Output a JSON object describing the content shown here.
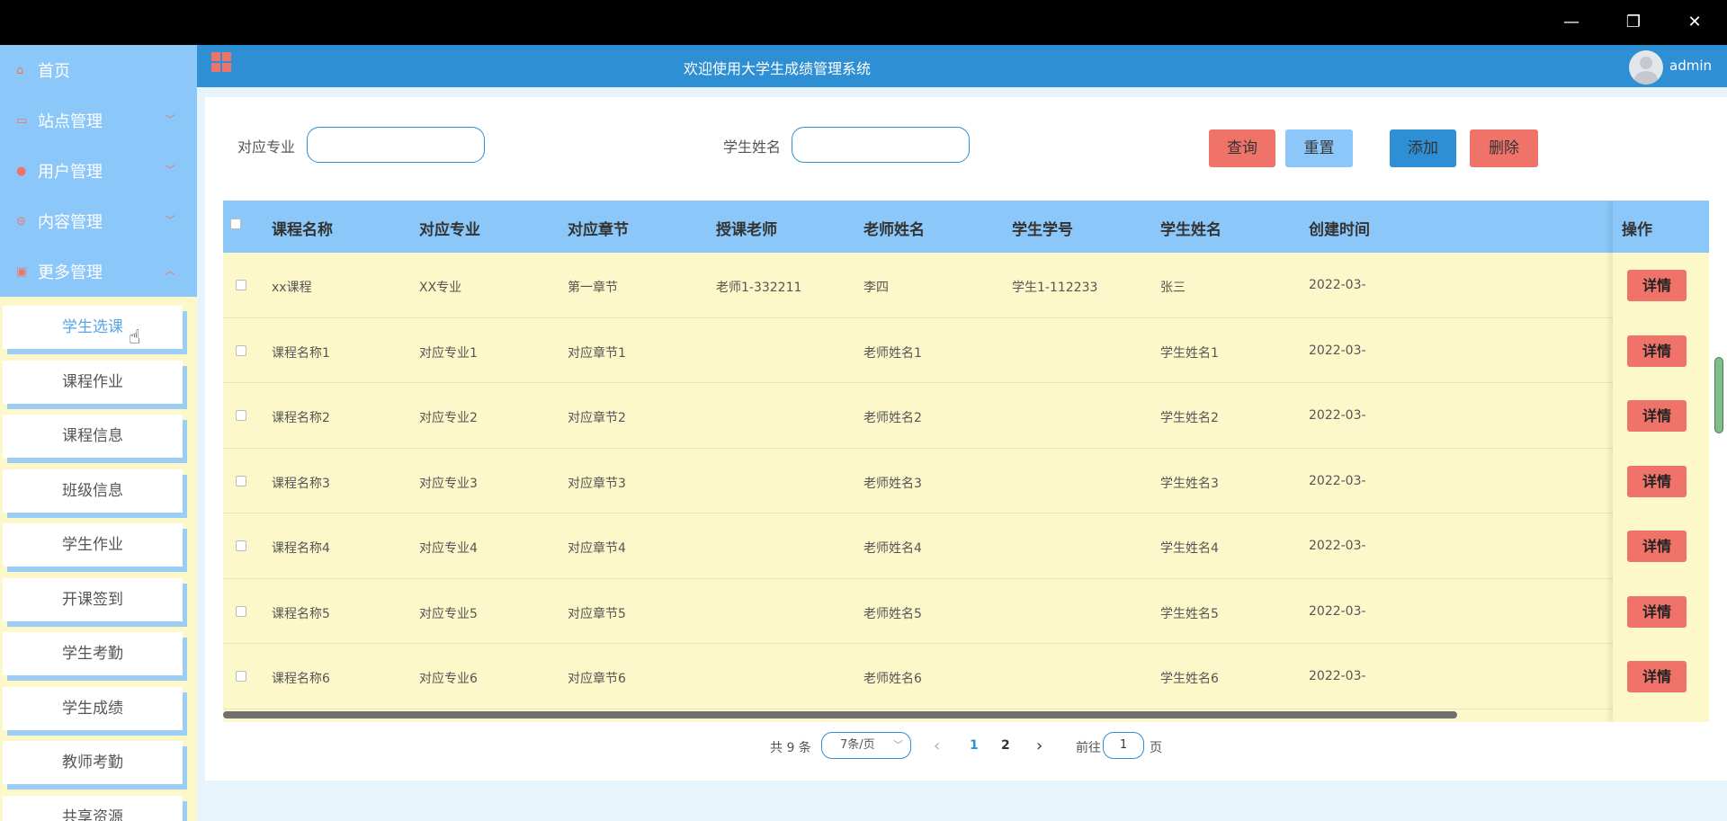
{
  "window": {
    "minimize": "—",
    "restore": "❐",
    "close": "✕"
  },
  "sidebar": {
    "menu": [
      {
        "label": "首页",
        "icon": "home-icon",
        "glyph": "⌂"
      },
      {
        "label": "站点管理",
        "icon": "monitor-icon",
        "glyph": "▭",
        "chevron": "﹀"
      },
      {
        "label": "用户管理",
        "icon": "user-icon",
        "glyph": "●",
        "chevron": "﹀"
      },
      {
        "label": "内容管理",
        "icon": "content-icon",
        "glyph": "⊝",
        "chevron": "﹀"
      },
      {
        "label": "更多管理",
        "icon": "more-icon",
        "glyph": "▣",
        "chevron": "︿"
      }
    ],
    "submenu": [
      "学生选课",
      "课程作业",
      "课程信息",
      "班级信息",
      "学生作业",
      "开课签到",
      "学生考勤",
      "学生成绩",
      "教师考勤",
      "共享资源"
    ]
  },
  "header": {
    "title": "欢迎使用大学生成绩管理系统",
    "username": "admin"
  },
  "search": {
    "major_label": "对应专业",
    "name_label": "学生姓名"
  },
  "buttons": {
    "query": "查询",
    "reset": "重置",
    "add": "添加",
    "delete": "删除"
  },
  "colors": {
    "primary": "#2e8fd4",
    "danger": "#f0736a",
    "header_bg": "#8cc7f9",
    "row_bg": "#fdf8c9",
    "reset_bg": "#8cc7f9"
  },
  "table": {
    "headers": [
      "课程名称",
      "对应专业",
      "对应章节",
      "授课老师",
      "老师姓名",
      "学生学号",
      "学生姓名",
      "创建时间",
      "操作"
    ],
    "detail_label": "详情",
    "rows": [
      [
        "xx课程",
        "XX专业",
        "第一章节",
        "老师1-332211",
        "李四",
        "学生1-112233",
        "张三",
        "2022-03-"
      ],
      [
        "课程名称1",
        "对应专业1",
        "对应章节1",
        "",
        "老师姓名1",
        "",
        "学生姓名1",
        "2022-03-"
      ],
      [
        "课程名称2",
        "对应专业2",
        "对应章节2",
        "",
        "老师姓名2",
        "",
        "学生姓名2",
        "2022-03-"
      ],
      [
        "课程名称3",
        "对应专业3",
        "对应章节3",
        "",
        "老师姓名3",
        "",
        "学生姓名3",
        "2022-03-"
      ],
      [
        "课程名称4",
        "对应专业4",
        "对应章节4",
        "",
        "老师姓名4",
        "",
        "学生姓名4",
        "2022-03-"
      ],
      [
        "课程名称5",
        "对应专业5",
        "对应章节5",
        "",
        "老师姓名5",
        "",
        "学生姓名5",
        "2022-03-"
      ],
      [
        "课程名称6",
        "对应专业6",
        "对应章节6",
        "",
        "老师姓名6",
        "",
        "学生姓名6",
        "2022-03-"
      ]
    ]
  },
  "pagination": {
    "total": "共 9 条",
    "page_size": "7条/页",
    "prev": "‹",
    "pages": [
      "1",
      "2"
    ],
    "next": "›",
    "goto": "前往",
    "goto_value": "1",
    "page_suffix": "页"
  }
}
